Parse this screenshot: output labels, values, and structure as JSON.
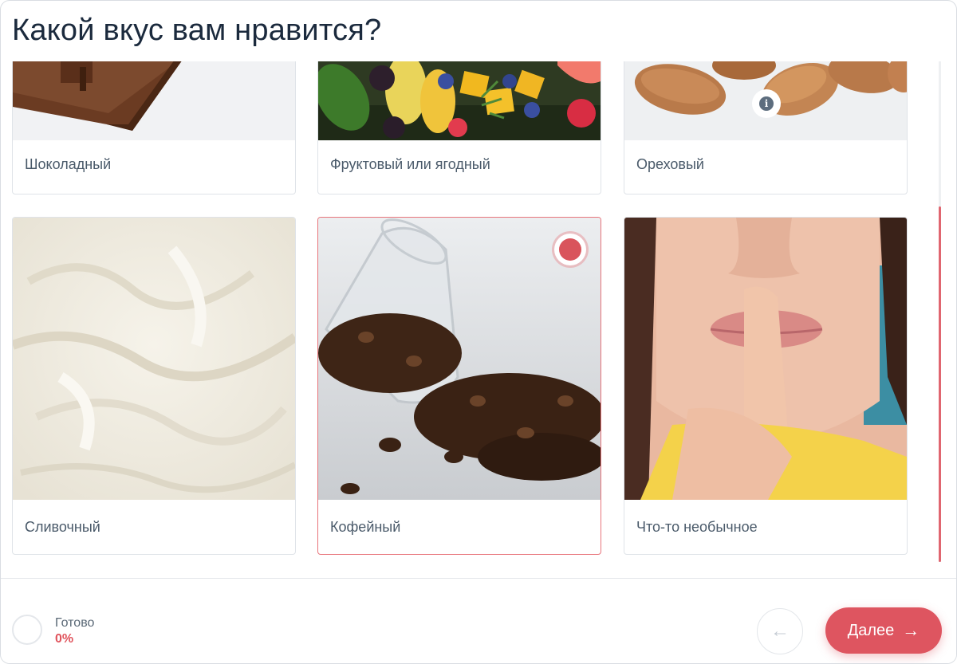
{
  "question": {
    "title": "Какой вкус вам нравится?"
  },
  "options": [
    {
      "label": "Шоколадный",
      "image": "chocolate-bar-photo",
      "selected": false
    },
    {
      "label": "Фруктовый или ягодный",
      "image": "fruit-berries-photo",
      "selected": false
    },
    {
      "label": "Ореховый",
      "image": "almonds-photo",
      "selected": false,
      "has_info": true
    },
    {
      "label": "Сливочный",
      "image": "whipped-cream-photo",
      "selected": false
    },
    {
      "label": "Кофейный",
      "image": "coffee-beans-photo",
      "selected": true
    },
    {
      "label": "Что-то необычное",
      "image": "woman-finger-on-lips-photo",
      "selected": false
    }
  ],
  "footer": {
    "progress_label": "Готово",
    "progress_value": "0%",
    "back_icon": "arrow-left-icon",
    "next_label": "Далее",
    "next_icon": "arrow-right-icon"
  },
  "colors": {
    "accent": "#de5560",
    "selected_border": "#e8747b",
    "title": "#1b2a3d",
    "label": "#4a5a6a"
  }
}
